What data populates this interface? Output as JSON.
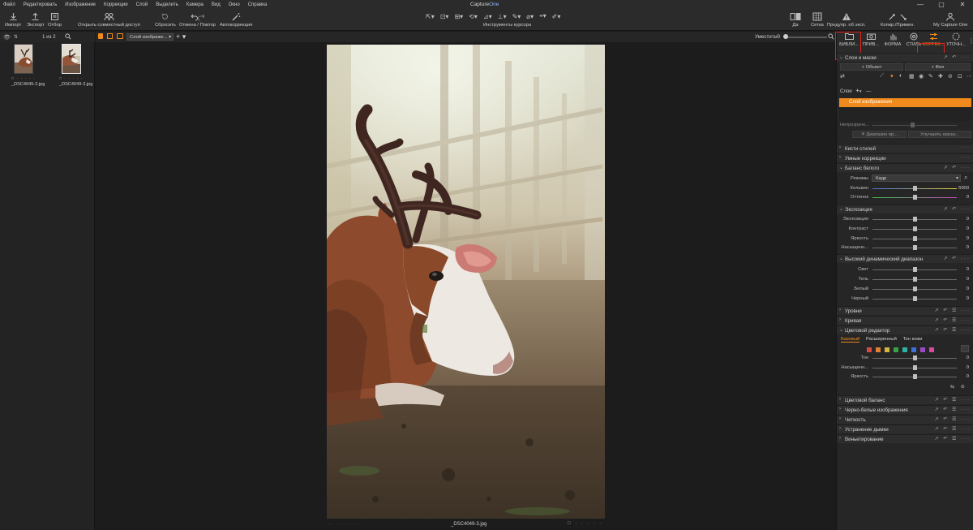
{
  "app": {
    "title_prefix": "Capture",
    "title_version": "One",
    "window_controls": [
      "—",
      "▢",
      "✕"
    ]
  },
  "menu": [
    "Файл",
    "Редактировать",
    "Изображение",
    "Коррекции",
    "Слой",
    "Выделить",
    "Камера",
    "Вид",
    "Окно",
    "Справка"
  ],
  "toolbar": {
    "import": "Импорт",
    "export": "Экспорт",
    "select": "Отбор",
    "share": "Открыть совместный доступ",
    "reset": "Сбросить",
    "undo_redo": "Отмена / Повтор",
    "auto": "Автокоррекция",
    "cursor_tools": "Инструменты курсора",
    "view": "Да",
    "grid": "Сетка",
    "warning": "Предупр. об эксп.",
    "copy_apply": "Копир./Примен.",
    "my_capture_one": "My Capture One"
  },
  "browser": {
    "count": "1 из 2",
    "thumbnails": [
      {
        "filename": "_DSC4045-2.jpg",
        "selected": false
      },
      {
        "filename": "_DSC4049-3.jpg",
        "selected": true
      }
    ]
  },
  "viewer": {
    "layer": "Слой изображе...",
    "fit": "Уместить",
    "filename": "_DSC4049-3.jpg"
  },
  "tool_tabs": [
    {
      "label": "БИБЛИ...",
      "icon": "folder-icon"
    },
    {
      "label": "ПРИВ...",
      "icon": "camera-icon"
    },
    {
      "label": "ФОРМА",
      "icon": "hand-icon"
    },
    {
      "label": "СТИЛЬ",
      "icon": "palette-icon"
    },
    {
      "label": "КОРРЕК...",
      "icon": "sliders-icon",
      "active": true
    },
    {
      "label": "УТОЧН...",
      "icon": "details-icon"
    }
  ],
  "layers": {
    "title": "Слои и маски",
    "object": "Объект",
    "background": "Фон",
    "layers_label": "Слои",
    "layer_name": "Слой изображения",
    "opacity_label": "Непрозрачн...",
    "diapason_button": "Диапазон яр...",
    "refine_button": "Улучшить маску..."
  },
  "sections": {
    "style_brushes": "Кисти стилей",
    "smart": "Умные коррекции",
    "white_balance": "Баланс белого",
    "exposure": "Экспозиция",
    "hdr": "Высокий динамический диапазон",
    "levels": "Уровни",
    "curve": "Кривая",
    "color_editor": "Цветовой редактор",
    "color_balance": "Цветовой баланс",
    "bw": "Черно-белые изображения",
    "clarity": "Четкость",
    "dehaze": "Устранение дымки",
    "vignette": "Виньетирование"
  },
  "white_balance": {
    "mode_label": "Режимы",
    "mode_value": "Кадр",
    "kelvin_label": "Кельвин",
    "kelvin_value": "5000",
    "tint_label": "Оттенок",
    "tint_value": "0"
  },
  "exposure": {
    "rows": [
      {
        "label": "Экспозиция",
        "value": "0"
      },
      {
        "label": "Контраст",
        "value": "0"
      },
      {
        "label": "Яркость",
        "value": "0"
      },
      {
        "label": "Насыщенн...",
        "value": "0"
      }
    ]
  },
  "hdr": {
    "rows": [
      {
        "label": "Свет",
        "value": "0"
      },
      {
        "label": "Тень",
        "value": "0"
      },
      {
        "label": "Белый",
        "value": "0"
      },
      {
        "label": "Черный",
        "value": "0"
      }
    ]
  },
  "color_editor": {
    "tabs": [
      "Базовый",
      "Расширенный",
      "Тон кожи"
    ],
    "active_tab": "Базовый",
    "swatches": [
      "#d64a4a",
      "#e0812f",
      "#d7b640",
      "#3aa34a",
      "#2fb3a9",
      "#3f6fd8",
      "#9b49c6",
      "#d64aa0"
    ],
    "rows": [
      {
        "label": "Тон",
        "value": "0"
      },
      {
        "label": "Насыщенн...",
        "value": "0"
      },
      {
        "label": "Яркость",
        "value": "0"
      }
    ]
  },
  "colors": {
    "accent": "#f08a1c",
    "highlight_box": "#e2231a"
  }
}
